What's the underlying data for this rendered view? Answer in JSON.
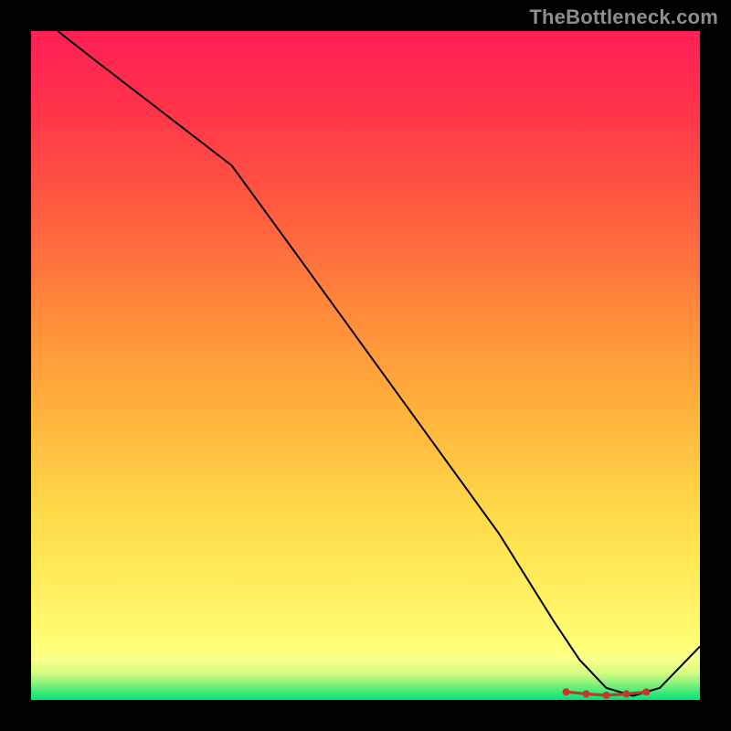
{
  "watermark": "TheBottleneck.com",
  "chart_data": {
    "type": "line",
    "title": "",
    "xlabel": "",
    "ylabel": "",
    "xlim": [
      0,
      100
    ],
    "ylim": [
      0,
      100
    ],
    "grid": false,
    "legend": false,
    "series": [
      {
        "name": "bottleneck-curve",
        "x": [
          4,
          10,
          20,
          30,
          40,
          50,
          60,
          70,
          78,
          82,
          86,
          90,
          94,
          100
        ],
        "values": [
          100,
          95.3,
          87.6,
          79.9,
          66.2,
          52.4,
          38.6,
          24.8,
          12.0,
          6.0,
          1.8,
          0.6,
          1.8,
          8.0
        ]
      }
    ],
    "markers": {
      "name": "optimal-range",
      "x": [
        80,
        83,
        86,
        89,
        92
      ],
      "values": [
        1.2,
        0.9,
        0.7,
        0.9,
        1.2
      ]
    },
    "gradient_stops": [
      {
        "pct": 0.0,
        "color": "#00e37a"
      },
      {
        "pct": 2.0,
        "color": "#6df07a"
      },
      {
        "pct": 4.0,
        "color": "#d6fa80"
      },
      {
        "pct": 6.0,
        "color": "#f9ff8a"
      },
      {
        "pct": 8.0,
        "color": "#ffff78"
      },
      {
        "pct": 16.0,
        "color": "#fff060"
      },
      {
        "pct": 28.0,
        "color": "#ffda4a"
      },
      {
        "pct": 42.0,
        "color": "#ffb53d"
      },
      {
        "pct": 58.0,
        "color": "#ff8a3a"
      },
      {
        "pct": 74.0,
        "color": "#ff5a40"
      },
      {
        "pct": 88.0,
        "color": "#ff3449"
      },
      {
        "pct": 100.0,
        "color": "#ff1f55"
      }
    ]
  }
}
